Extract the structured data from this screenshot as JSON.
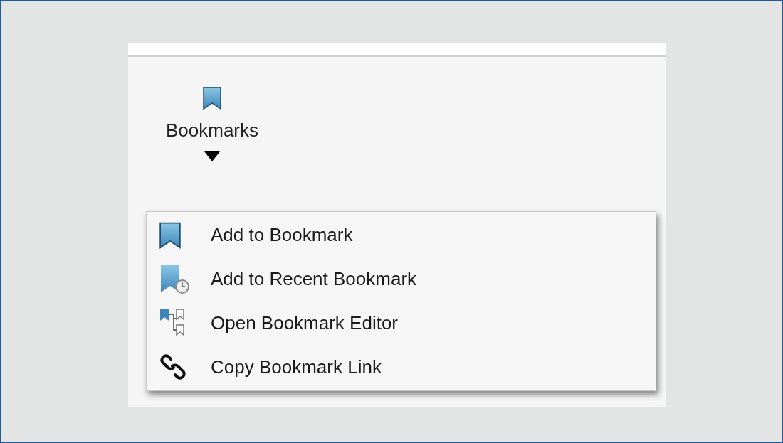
{
  "ribbon_button": {
    "label": "Bookmarks",
    "expanded": true
  },
  "menu": {
    "items": [
      {
        "kind": "bookmark",
        "label": "Add to Bookmark"
      },
      {
        "kind": "recent",
        "label": "Add to Recent Bookmark"
      },
      {
        "kind": "editor",
        "label": "Open Bookmark Editor"
      },
      {
        "kind": "link",
        "label": "Copy Bookmark Link"
      }
    ]
  }
}
